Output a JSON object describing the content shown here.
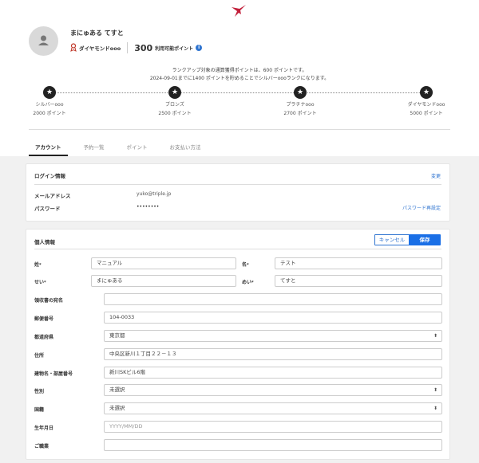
{
  "user": {
    "name": "まにゅある てすと",
    "rank": "ダイヤモンドooo",
    "points": "300",
    "points_label": "利用可能ポイント"
  },
  "rank_message": {
    "line1": "ランクアップ対象の通算獲得ポイントは、600 ポイントです。",
    "line2": "2024-09-01までに1400 ポイントを貯めることでシルバーoooランクになります。"
  },
  "ranks": [
    {
      "name": "シルバーooo",
      "points": "2000 ポイント"
    },
    {
      "name": "ブロンズ",
      "points": "2500 ポイント"
    },
    {
      "name": "プラチナooo",
      "points": "2700 ポイント"
    },
    {
      "name": "ダイヤモンドooo",
      "points": "5000 ポイント"
    }
  ],
  "tabs": [
    "アカウント",
    "予約一覧",
    "ポイント",
    "お支払い方法"
  ],
  "login": {
    "title": "ログイン情報",
    "edit": "変更",
    "email_label": "メールアドレス",
    "email": "yuko@triple.jp",
    "password_label": "パスワード",
    "password": "••••••••",
    "reset": "パスワード再設定"
  },
  "personal": {
    "title": "個人情報",
    "cancel": "キャンセル",
    "save": "保存",
    "last_name_label": "姓",
    "last_name": "マニュアル",
    "first_name_label": "名",
    "first_name": "テスト",
    "last_kana_label": "せい",
    "last_kana": "まにゅある",
    "first_kana_label": "めい",
    "first_kana": "てすと",
    "receipt_label": "領収書の宛名",
    "receipt": "",
    "zip_label": "郵便番号",
    "zip": "104-0033",
    "pref_label": "都道府県",
    "pref": "東京都",
    "address_label": "住所",
    "address": "中央区新川１丁目２２－１３",
    "building_label": "建物名・部屋番号",
    "building": "新川SKビル6階",
    "gender_label": "性別",
    "gender": "未選択",
    "nationality_label": "国籍",
    "nationality": "未選択",
    "birthday_label": "生年月日",
    "birthday_placeholder": "YYYY/MM/DD",
    "job_label": "ご職業",
    "job": ""
  },
  "colors": {
    "accent": "#1a6fe6",
    "rank_badge": "#c0392b"
  }
}
